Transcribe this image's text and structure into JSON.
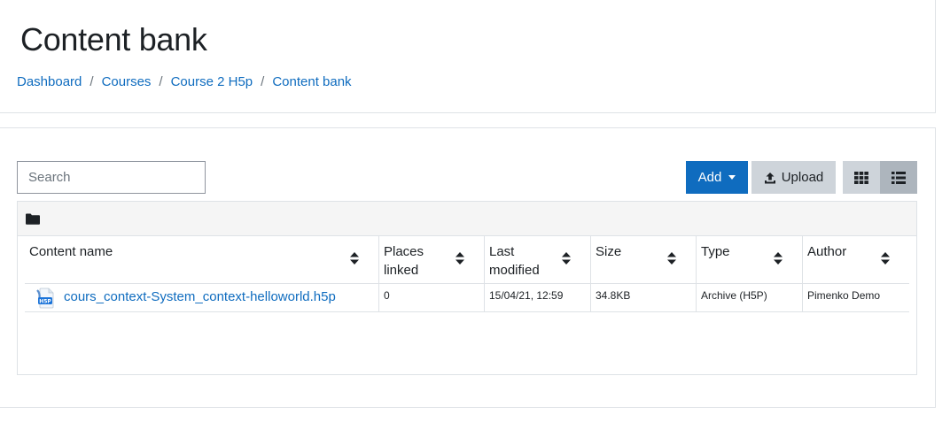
{
  "page": {
    "title": "Content bank"
  },
  "breadcrumb": [
    {
      "label": "Dashboard"
    },
    {
      "label": "Courses"
    },
    {
      "label": "Course 2 H5p"
    },
    {
      "label": "Content bank"
    }
  ],
  "breadcrumb_separator": "/",
  "search": {
    "placeholder": "Search",
    "value": ""
  },
  "toolbar": {
    "add_label": "Add",
    "upload_label": "Upload",
    "grid_icon": "grid-view-icon",
    "list_icon": "list-view-icon"
  },
  "table": {
    "columns": [
      {
        "label": "Content name"
      },
      {
        "label": "Places linked"
      },
      {
        "label": "Last modified"
      },
      {
        "label": "Size"
      },
      {
        "label": "Type"
      },
      {
        "label": "Author"
      }
    ],
    "rows": [
      {
        "name": "cours_context-System_context-helloworld.h5p",
        "places_linked": "0",
        "last_modified": "15/04/21, 12:59",
        "size": "34.8KB",
        "type": "Archive (H5P)",
        "author": "Pimenko Demo"
      }
    ]
  },
  "colors": {
    "accent": "#0f6cbf",
    "secondary_button": "#ced4da",
    "active_toggle": "#adb5bd"
  }
}
